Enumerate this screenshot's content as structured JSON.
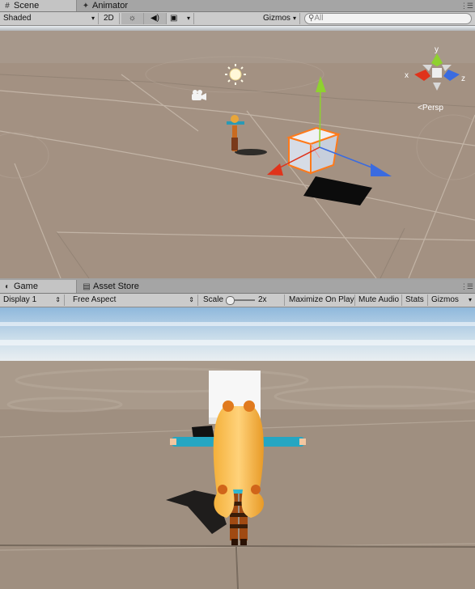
{
  "scene_panel": {
    "tabs": [
      {
        "label": "Scene",
        "icon": "scene-icon",
        "active": true
      },
      {
        "label": "Animator",
        "icon": "animator-icon",
        "active": false
      }
    ],
    "toolbar": {
      "shading_mode": "Shaded",
      "mode_2d": "2D",
      "gizmos": "Gizmos",
      "search_placeholder": "All"
    },
    "orientation_gizmo": {
      "y": "y",
      "x": "x",
      "z": "z",
      "projection": "Persp"
    }
  },
  "game_panel": {
    "tabs": [
      {
        "label": "Game",
        "icon": "game-icon",
        "active": true
      },
      {
        "label": "Asset Store",
        "icon": "asset-store-icon",
        "active": false
      }
    ],
    "toolbar": {
      "display": "Display 1",
      "aspect": "Free Aspect",
      "scale_label": "Scale",
      "scale_value": "2x",
      "scale_fraction": 0.05,
      "maximize_on_play": "Maximize On Play",
      "mute_audio": "Mute Audio",
      "stats": "Stats",
      "gizmos": "Gizmos"
    }
  },
  "colors": {
    "chrome": "#a5a5a5",
    "toolbar": "#cbcbcb",
    "ground": "#a19081",
    "sky": "#b8d4ea",
    "selection_outline": "#ff7a1a",
    "axis_x": "#e0331b",
    "axis_y": "#8fd12f",
    "axis_z": "#3a6be0"
  }
}
